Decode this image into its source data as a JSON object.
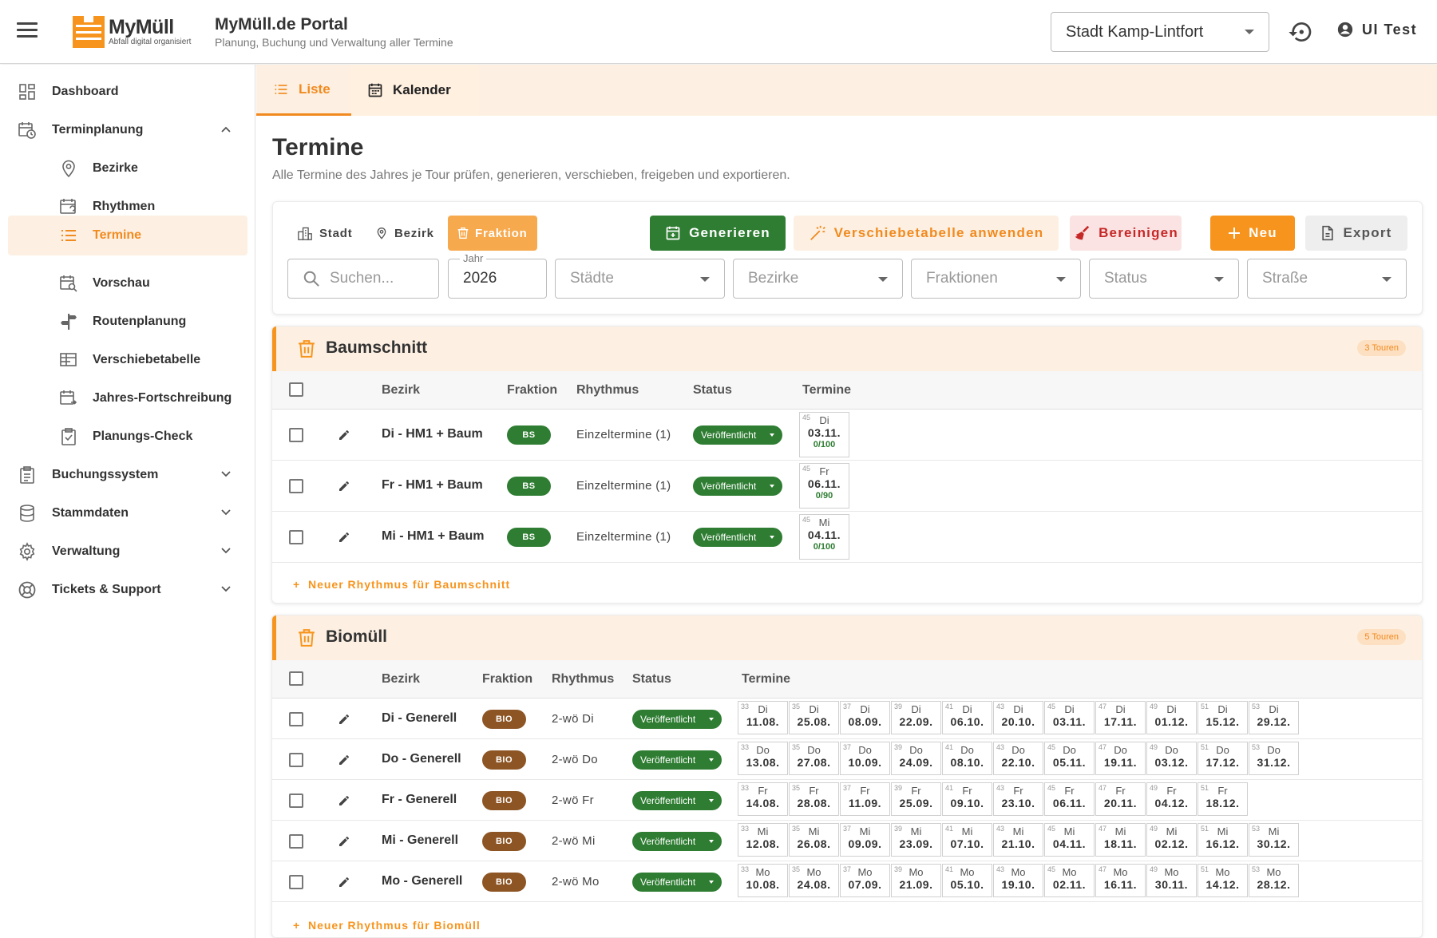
{
  "header": {
    "logo_name": "MyMüll",
    "logo_tagline": "Abfall digital organisiert",
    "title": "MyMüll.de Portal",
    "subtitle": "Planung, Buchung und Verwaltung aller Termine",
    "city": "Stadt Kamp-Lintfort",
    "user": "UI Test"
  },
  "sidebar": {
    "dashboard": "Dashboard",
    "terminplanung": "Terminplanung",
    "bezirke": "Bezirke",
    "rhythmen": "Rhythmen",
    "termine": "Termine",
    "vorschau": "Vorschau",
    "routenplanung": "Routenplanung",
    "verschiebetabelle": "Verschiebetabelle",
    "jahres": "Jahres-Fortschreibung",
    "check": "Planungs-Check",
    "buchung": "Buchungssystem",
    "stamm": "Stammdaten",
    "verwaltung": "Verwaltung",
    "tickets": "Tickets & Support"
  },
  "tabs": {
    "liste": "Liste",
    "kalender": "Kalender"
  },
  "page": {
    "title": "Termine",
    "description": "Alle Termine des Jahres je Tour prüfen, generieren, verschieben, freigeben und exportieren."
  },
  "toolbar": {
    "seg_stadt": "Stadt",
    "seg_bezirk": "Bezirk",
    "seg_fraktion": "Fraktion",
    "generieren": "Generieren",
    "verschiebetabelle": "Verschiebetabelle anwenden",
    "bereinigen": "Bereinigen",
    "neu": "Neu",
    "export": "Export"
  },
  "filters": {
    "search_placeholder": "Suchen...",
    "year_label": "Jahr",
    "year": "2026",
    "staedte": "Städte",
    "bezirke": "Bezirke",
    "fraktionen": "Fraktionen",
    "status": "Status",
    "strasse": "Straße"
  },
  "columns": {
    "bezirk": "Bezirk",
    "fraktion": "Fraktion",
    "rhythmus": "Rhythmus",
    "status": "Status",
    "termine": "Termine"
  },
  "baumschnitt": {
    "title": "Baumschnitt",
    "badge": "3 Touren",
    "new_rhythm": "Neuer Rhythmus für Baumschnitt",
    "rows": [
      {
        "bezirk": "Di - HM1 + Baum",
        "fraktion": "BS",
        "rhythmus": "Einzeltermine (1)",
        "status": "Veröffentlicht",
        "termine": [
          {
            "wk": "45",
            "day": "Di",
            "date": "03.11.",
            "cap": "0/100"
          }
        ]
      },
      {
        "bezirk": "Fr - HM1 + Baum",
        "fraktion": "BS",
        "rhythmus": "Einzeltermine (1)",
        "status": "Veröffentlicht",
        "termine": [
          {
            "wk": "45",
            "day": "Fr",
            "date": "06.11.",
            "cap": "0/90"
          }
        ]
      },
      {
        "bezirk": "Mi - HM1 + Baum",
        "fraktion": "BS",
        "rhythmus": "Einzeltermine (1)",
        "status": "Veröffentlicht",
        "termine": [
          {
            "wk": "45",
            "day": "Mi",
            "date": "04.11.",
            "cap": "0/100"
          }
        ]
      }
    ]
  },
  "biomuell": {
    "title": "Biomüll",
    "badge": "5 Touren",
    "new_rhythm": "Neuer Rhythmus für Biomüll",
    "rows": [
      {
        "bezirk": "Di - Generell",
        "fraktion": "BIO",
        "rhythmus": "2-wö Di",
        "status": "Veröffentlicht",
        "termine": [
          {
            "wk": "33",
            "day": "Di",
            "date": "11.08."
          },
          {
            "wk": "35",
            "day": "Di",
            "date": "25.08."
          },
          {
            "wk": "37",
            "day": "Di",
            "date": "08.09."
          },
          {
            "wk": "39",
            "day": "Di",
            "date": "22.09."
          },
          {
            "wk": "41",
            "day": "Di",
            "date": "06.10."
          },
          {
            "wk": "43",
            "day": "Di",
            "date": "20.10."
          },
          {
            "wk": "45",
            "day": "Di",
            "date": "03.11."
          },
          {
            "wk": "47",
            "day": "Di",
            "date": "17.11."
          },
          {
            "wk": "49",
            "day": "Di",
            "date": "01.12."
          },
          {
            "wk": "51",
            "day": "Di",
            "date": "15.12."
          },
          {
            "wk": "53",
            "day": "Di",
            "date": "29.12."
          }
        ]
      },
      {
        "bezirk": "Do - Generell",
        "fraktion": "BIO",
        "rhythmus": "2-wö Do",
        "status": "Veröffentlicht",
        "termine": [
          {
            "wk": "33",
            "day": "Do",
            "date": "13.08."
          },
          {
            "wk": "35",
            "day": "Do",
            "date": "27.08."
          },
          {
            "wk": "37",
            "day": "Do",
            "date": "10.09."
          },
          {
            "wk": "39",
            "day": "Do",
            "date": "24.09."
          },
          {
            "wk": "41",
            "day": "Do",
            "date": "08.10."
          },
          {
            "wk": "43",
            "day": "Do",
            "date": "22.10."
          },
          {
            "wk": "45",
            "day": "Do",
            "date": "05.11."
          },
          {
            "wk": "47",
            "day": "Do",
            "date": "19.11."
          },
          {
            "wk": "49",
            "day": "Do",
            "date": "03.12."
          },
          {
            "wk": "51",
            "day": "Do",
            "date": "17.12."
          },
          {
            "wk": "53",
            "day": "Do",
            "date": "31.12."
          }
        ]
      },
      {
        "bezirk": "Fr - Generell",
        "fraktion": "BIO",
        "rhythmus": "2-wö Fr",
        "status": "Veröffentlicht",
        "termine": [
          {
            "wk": "33",
            "day": "Fr",
            "date": "14.08."
          },
          {
            "wk": "35",
            "day": "Fr",
            "date": "28.08."
          },
          {
            "wk": "37",
            "day": "Fr",
            "date": "11.09."
          },
          {
            "wk": "39",
            "day": "Fr",
            "date": "25.09."
          },
          {
            "wk": "41",
            "day": "Fr",
            "date": "09.10."
          },
          {
            "wk": "43",
            "day": "Fr",
            "date": "23.10."
          },
          {
            "wk": "45",
            "day": "Fr",
            "date": "06.11."
          },
          {
            "wk": "47",
            "day": "Fr",
            "date": "20.11."
          },
          {
            "wk": "49",
            "day": "Fr",
            "date": "04.12."
          },
          {
            "wk": "51",
            "day": "Fr",
            "date": "18.12."
          }
        ]
      },
      {
        "bezirk": "Mi - Generell",
        "fraktion": "BIO",
        "rhythmus": "2-wö Mi",
        "status": "Veröffentlicht",
        "termine": [
          {
            "wk": "33",
            "day": "Mi",
            "date": "12.08."
          },
          {
            "wk": "35",
            "day": "Mi",
            "date": "26.08."
          },
          {
            "wk": "37",
            "day": "Mi",
            "date": "09.09."
          },
          {
            "wk": "39",
            "day": "Mi",
            "date": "23.09."
          },
          {
            "wk": "41",
            "day": "Mi",
            "date": "07.10."
          },
          {
            "wk": "43",
            "day": "Mi",
            "date": "21.10."
          },
          {
            "wk": "45",
            "day": "Mi",
            "date": "04.11."
          },
          {
            "wk": "47",
            "day": "Mi",
            "date": "18.11."
          },
          {
            "wk": "49",
            "day": "Mi",
            "date": "02.12."
          },
          {
            "wk": "51",
            "day": "Mi",
            "date": "16.12."
          },
          {
            "wk": "53",
            "day": "Mi",
            "date": "30.12."
          }
        ]
      },
      {
        "bezirk": "Mo - Generell",
        "fraktion": "BIO",
        "rhythmus": "2-wö Mo",
        "status": "Veröffentlicht",
        "termine": [
          {
            "wk": "33",
            "day": "Mo",
            "date": "10.08."
          },
          {
            "wk": "35",
            "day": "Mo",
            "date": "24.08."
          },
          {
            "wk": "37",
            "day": "Mo",
            "date": "07.09."
          },
          {
            "wk": "39",
            "day": "Mo",
            "date": "21.09."
          },
          {
            "wk": "41",
            "day": "Mo",
            "date": "05.10."
          },
          {
            "wk": "43",
            "day": "Mo",
            "date": "19.10."
          },
          {
            "wk": "45",
            "day": "Mo",
            "date": "02.11."
          },
          {
            "wk": "47",
            "day": "Mo",
            "date": "16.11."
          },
          {
            "wk": "49",
            "day": "Mo",
            "date": "30.11."
          },
          {
            "wk": "51",
            "day": "Mo",
            "date": "14.12."
          },
          {
            "wk": "53",
            "day": "Mo",
            "date": "28.12."
          }
        ]
      }
    ]
  },
  "colors": {
    "accent": "#f7941d",
    "accent_light": "#fdf0e2",
    "success": "#2e7d32",
    "bio": "#8d5524",
    "danger": "#c62828"
  }
}
